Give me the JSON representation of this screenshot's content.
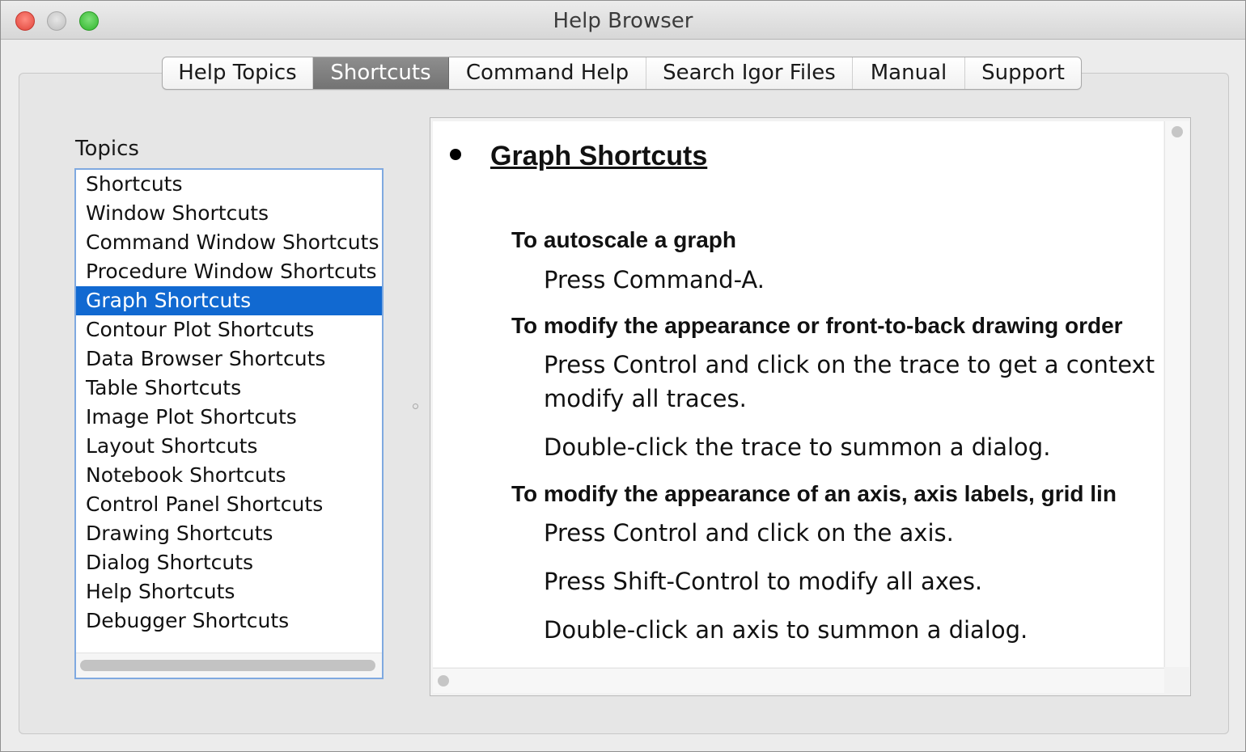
{
  "window": {
    "title": "Help Browser"
  },
  "tabs": [
    {
      "label": "Help Topics",
      "selected": false
    },
    {
      "label": "Shortcuts",
      "selected": true
    },
    {
      "label": "Command Help",
      "selected": false
    },
    {
      "label": "Search Igor Files",
      "selected": false
    },
    {
      "label": "Manual",
      "selected": false
    },
    {
      "label": "Support",
      "selected": false
    }
  ],
  "topics": {
    "label": "Topics",
    "selected_index": 4,
    "items": [
      "Shortcuts",
      "Window Shortcuts",
      "Command Window Shortcuts",
      "Procedure Window Shortcuts",
      "Graph Shortcuts",
      "Contour Plot Shortcuts",
      "Data Browser Shortcuts",
      "Table Shortcuts",
      "Image Plot Shortcuts",
      "Layout Shortcuts",
      "Notebook Shortcuts",
      "Control Panel Shortcuts",
      "Drawing Shortcuts",
      "Dialog Shortcuts",
      "Help Shortcuts",
      "Debugger Shortcuts"
    ]
  },
  "content": {
    "heading": "Graph Shortcuts",
    "sections": [
      {
        "title": "To autoscale a graph",
        "lines": [
          "Press Command-A."
        ]
      },
      {
        "title": "To modify the appearance or front-to-back drawing order",
        "lines": [
          "Press Control and click on the trace to get a context",
          "modify all traces.",
          "Double-click the trace to summon a dialog."
        ]
      },
      {
        "title": "To modify the appearance of an axis, axis labels, grid lin",
        "lines": [
          "Press Control and click on the axis.",
          "Press Shift-Control to modify all axes.",
          "Double-click an axis to summon a dialog."
        ]
      }
    ]
  }
}
